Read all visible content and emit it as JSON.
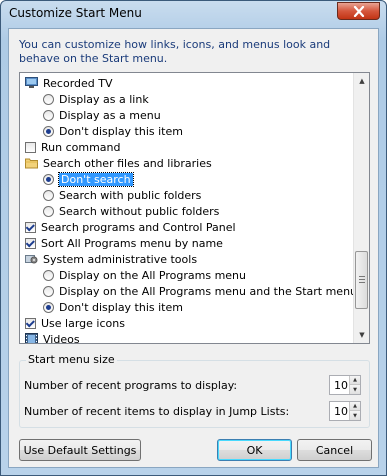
{
  "window": {
    "title": "Customize Start Menu"
  },
  "description": "You can customize how links, icons, and menus look and behave on the Start menu.",
  "options_list": [
    {
      "type": "header",
      "icon": "monitor-icon",
      "label": "Recorded TV"
    },
    {
      "type": "radio",
      "checked": false,
      "label": "Display as a link"
    },
    {
      "type": "radio",
      "checked": false,
      "label": "Display as a menu"
    },
    {
      "type": "radio",
      "checked": true,
      "label": "Don't display this item"
    },
    {
      "type": "checkbox",
      "checked": false,
      "label": "Run command"
    },
    {
      "type": "header",
      "icon": "folder-icon",
      "label": "Search other files and libraries"
    },
    {
      "type": "radio",
      "checked": true,
      "selected": true,
      "label": "Don't search"
    },
    {
      "type": "radio",
      "checked": false,
      "label": "Search with public folders"
    },
    {
      "type": "radio",
      "checked": false,
      "label": "Search without public folders"
    },
    {
      "type": "checkbox",
      "checked": true,
      "label": "Search programs and Control Panel"
    },
    {
      "type": "checkbox",
      "checked": true,
      "label": "Sort All Programs menu by name"
    },
    {
      "type": "header",
      "icon": "admin-tools-icon",
      "label": "System administrative tools"
    },
    {
      "type": "radio",
      "checked": false,
      "label": "Display on the All Programs menu"
    },
    {
      "type": "radio",
      "checked": false,
      "label": "Display on the All Programs menu and the Start menu"
    },
    {
      "type": "radio",
      "checked": true,
      "label": "Don't display this item"
    },
    {
      "type": "checkbox",
      "checked": true,
      "label": "Use large icons"
    },
    {
      "type": "header",
      "icon": "film-icon",
      "label": "Videos"
    }
  ],
  "start_menu_size": {
    "label": "Start menu size",
    "recent_programs_label": "Number of recent programs to display:",
    "recent_programs_value": "10",
    "recent_items_label": "Number of recent items to display in Jump Lists:",
    "recent_items_value": "10"
  },
  "buttons": {
    "default_settings": "Use Default Settings",
    "ok": "OK",
    "cancel": "Cancel"
  },
  "colors": {
    "selection": "#3399ff",
    "description_text": "#1a3b7a",
    "close_button": "#c23414"
  }
}
